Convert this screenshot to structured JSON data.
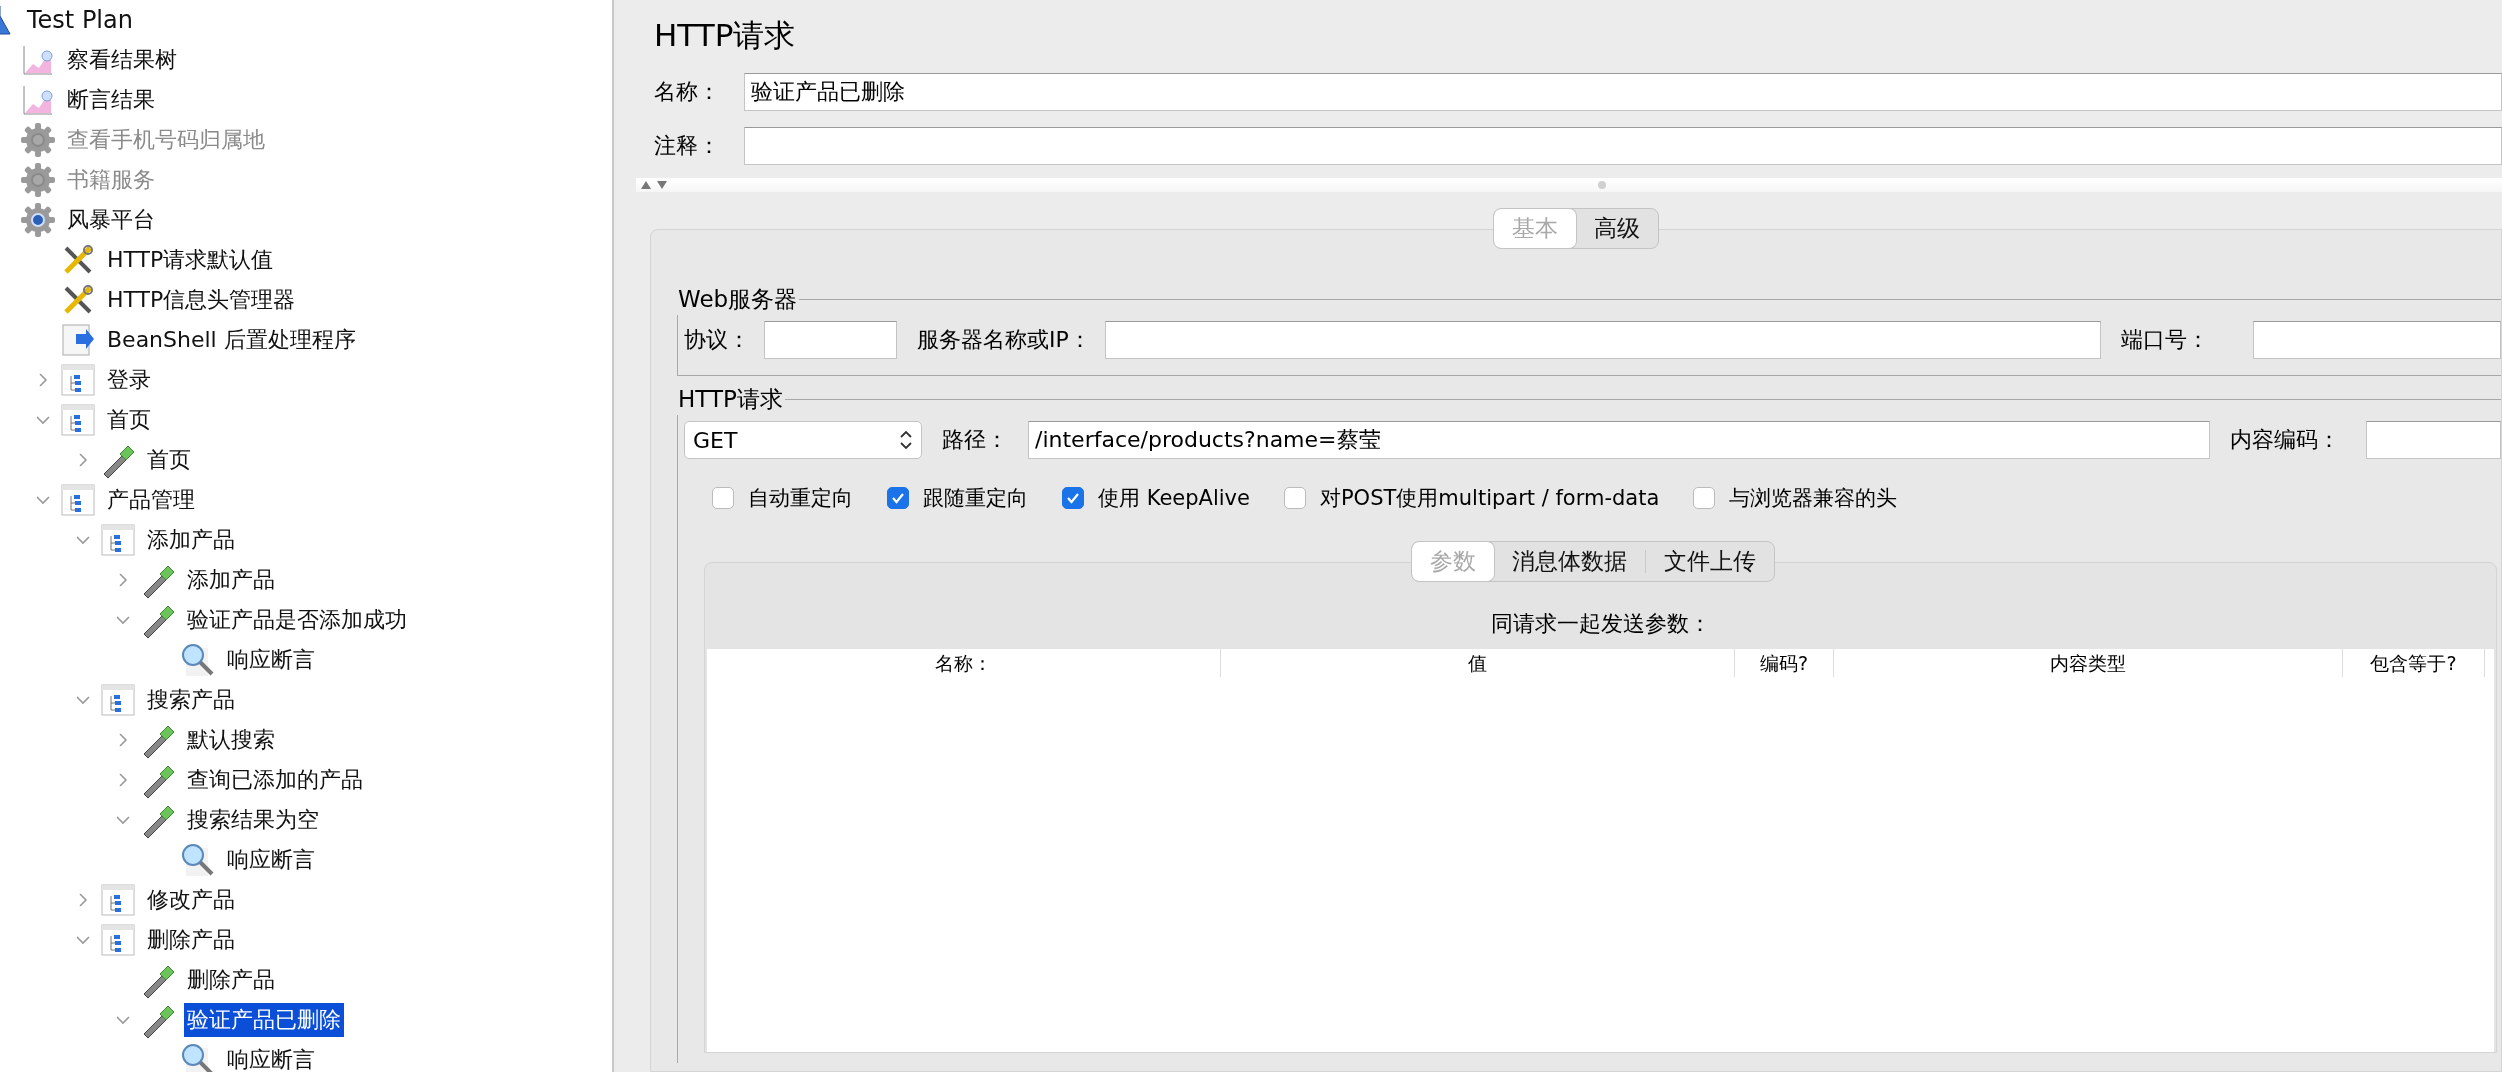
{
  "tree": {
    "root": {
      "label": "Test Plan",
      "kind": "testplan",
      "disabled": false,
      "selected": false,
      "children": [
        {
          "label": "察看结果树",
          "kind": "listener",
          "disabled": false,
          "selected": false
        },
        {
          "label": "断言结果",
          "kind": "listener",
          "disabled": false,
          "selected": false
        },
        {
          "label": "查看手机号码归属地",
          "kind": "gear",
          "disabled": true,
          "selected": false
        },
        {
          "label": "书籍服务",
          "kind": "gear",
          "disabled": true,
          "selected": false
        },
        {
          "label": "风暴平台",
          "kind": "gear",
          "disabled": false,
          "selected": false,
          "children": [
            {
              "label": "HTTP请求默认值",
              "kind": "tools",
              "disabled": false,
              "selected": false
            },
            {
              "label": "HTTP信息头管理器",
              "kind": "tools",
              "disabled": false,
              "selected": false
            },
            {
              "label": "BeanShell 后置处理程序",
              "kind": "script",
              "disabled": false,
              "selected": false
            },
            {
              "label": "登录",
              "kind": "controller",
              "disabled": false,
              "selected": false,
              "expanded": false
            },
            {
              "label": "首页",
              "kind": "controller",
              "disabled": false,
              "selected": false,
              "expanded": true,
              "children": [
                {
                  "label": "首页",
                  "kind": "sampler",
                  "disabled": false,
                  "selected": false,
                  "expanded": false
                }
              ]
            },
            {
              "label": "产品管理",
              "kind": "controller",
              "disabled": false,
              "selected": false,
              "expanded": true,
              "children": [
                {
                  "label": "添加产品",
                  "kind": "controller",
                  "disabled": false,
                  "selected": false,
                  "expanded": true,
                  "children": [
                    {
                      "label": "添加产品",
                      "kind": "sampler",
                      "disabled": false,
                      "selected": false,
                      "expanded": false
                    },
                    {
                      "label": "验证产品是否添加成功",
                      "kind": "sampler",
                      "disabled": false,
                      "selected": false,
                      "expanded": true,
                      "children": [
                        {
                          "label": "响应断言",
                          "kind": "assertion",
                          "disabled": false,
                          "selected": false
                        }
                      ]
                    }
                  ]
                },
                {
                  "label": "搜索产品",
                  "kind": "controller",
                  "disabled": false,
                  "selected": false,
                  "expanded": true,
                  "children": [
                    {
                      "label": "默认搜索",
                      "kind": "sampler",
                      "disabled": false,
                      "selected": false,
                      "expanded": false
                    },
                    {
                      "label": "查询已添加的产品",
                      "kind": "sampler",
                      "disabled": false,
                      "selected": false,
                      "expanded": false
                    },
                    {
                      "label": "搜索结果为空",
                      "kind": "sampler",
                      "disabled": false,
                      "selected": false,
                      "expanded": true,
                      "children": [
                        {
                          "label": "响应断言",
                          "kind": "assertion",
                          "disabled": false,
                          "selected": false
                        }
                      ]
                    }
                  ]
                },
                {
                  "label": "修改产品",
                  "kind": "controller",
                  "disabled": false,
                  "selected": false,
                  "expanded": false
                },
                {
                  "label": "删除产品",
                  "kind": "controller",
                  "disabled": false,
                  "selected": false,
                  "expanded": true,
                  "children": [
                    {
                      "label": "删除产品",
                      "kind": "sampler",
                      "disabled": false,
                      "selected": false
                    },
                    {
                      "label": "验证产品已删除",
                      "kind": "sampler",
                      "disabled": false,
                      "selected": true,
                      "expanded": true,
                      "children": [
                        {
                          "label": "响应断言",
                          "kind": "assertion",
                          "disabled": false,
                          "selected": false
                        }
                      ]
                    }
                  ]
                }
              ]
            }
          ]
        }
      ]
    }
  },
  "editor": {
    "title": "HTTP请求",
    "fields": [
      {
        "label": "名称：",
        "value": "验证产品已删除"
      },
      {
        "label": "注释："
      }
    ],
    "main_tabs": [
      {
        "label": "基本",
        "selected": true
      },
      {
        "label": "高级",
        "selected": false
      }
    ],
    "web_server": {
      "legend": "Web服务器",
      "fields": [
        {
          "label": "协议："
        },
        {
          "label": "服务器名称或IP："
        },
        {
          "label": "端口号："
        }
      ]
    },
    "http_request": {
      "legend": "HTTP请求",
      "method": "GET",
      "path_label": "路径：",
      "path": "/interface/products?name=蔡莹",
      "encoding_label": "内容编码：",
      "options": [
        {
          "label": "自动重定向",
          "checked": false
        },
        {
          "label": "跟随重定向",
          "checked": true
        },
        {
          "label": "使用 KeepAlive",
          "checked": true
        },
        {
          "label": "对POST使用multipart / form-data",
          "checked": false
        },
        {
          "label": "与浏览器兼容的头",
          "checked": false
        }
      ]
    },
    "sub_tabs": [
      {
        "label": "参数",
        "selected": true
      },
      {
        "label": "消息体数据",
        "selected": false
      },
      {
        "label": "文件上传",
        "selected": false
      }
    ],
    "parameters": {
      "title": "同请求一起发送参数：",
      "columns": [
        "名称：",
        "值",
        "编码?",
        "内容类型",
        "包含等于?"
      ]
    }
  }
}
